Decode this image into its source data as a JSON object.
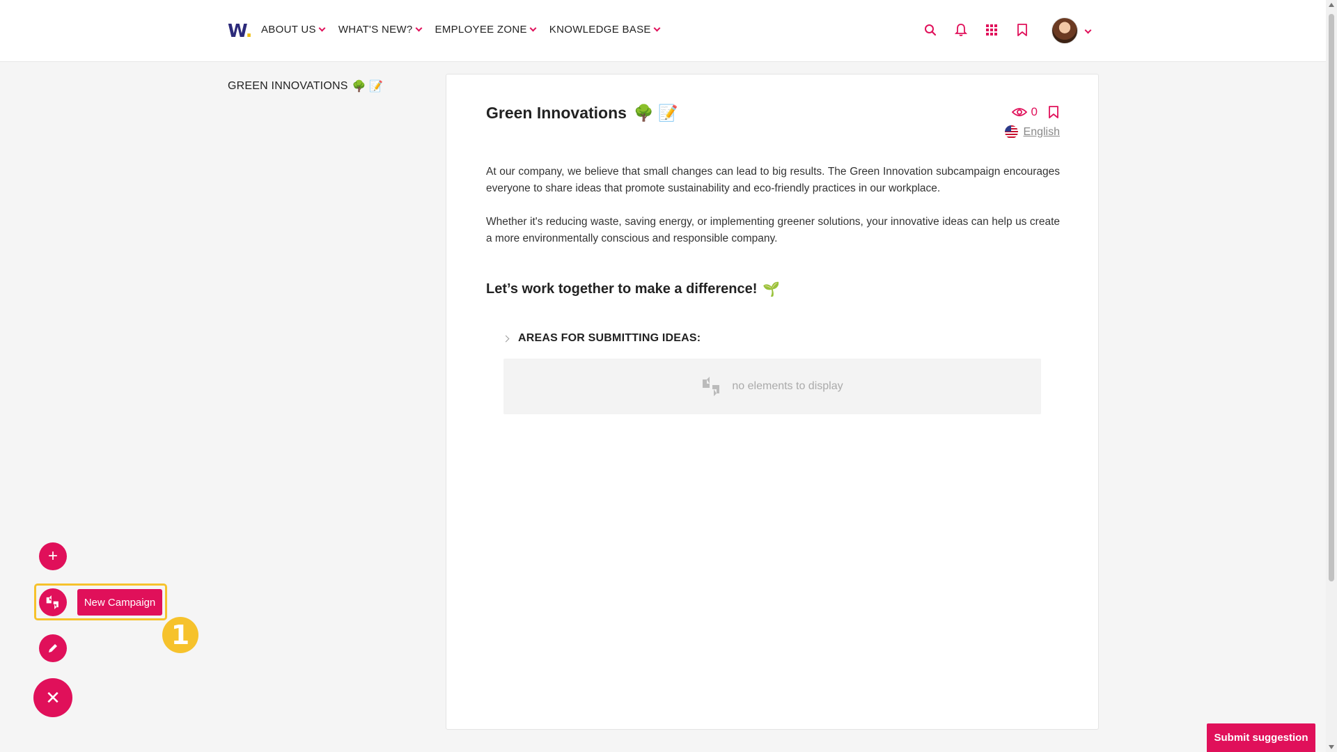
{
  "brand": {
    "logo_text": "W",
    "logo_dot": "."
  },
  "nav": {
    "items": [
      {
        "label": "ABOUT US"
      },
      {
        "label": "WHAT'S NEW?"
      },
      {
        "label": "EMPLOYEE ZONE"
      },
      {
        "label": "KNOWLEDGE BASE"
      }
    ],
    "icons": [
      "search-icon",
      "bell-icon",
      "apps-grid-icon",
      "bookmark-icon"
    ]
  },
  "breadcrumb": {
    "text": "GREEN INNOVATIONS",
    "emoji": "🌳 📝"
  },
  "page": {
    "title": "Green Innovations",
    "title_emoji": "🌳 📝",
    "views": "0",
    "language": "English",
    "paragraphs": [
      "At our company, we believe that small changes can lead to big results. The Green Innovation subcampaign encourages everyone to share ideas that promote sustainability and eco-friendly practices in our workplace.",
      "Whether it's reducing waste, saving energy, or implementing greener solutions, your innovative ideas can help us create a more environmentally conscious and responsible company."
    ],
    "subheading": "Let’s work together to make a difference!",
    "subheading_emoji": "🌱",
    "areas_label": "AREAS FOR SUBMITTING IDEAS:",
    "empty_text": "no elements to display"
  },
  "fab": {
    "add": "+",
    "new_campaign": "New Campaign",
    "close": "✕",
    "step": "1"
  },
  "submit_label": "Submit suggestion",
  "colors": {
    "accent": "#e0105a",
    "highlight": "#f6c22c",
    "brand": "#2c2a7a"
  }
}
